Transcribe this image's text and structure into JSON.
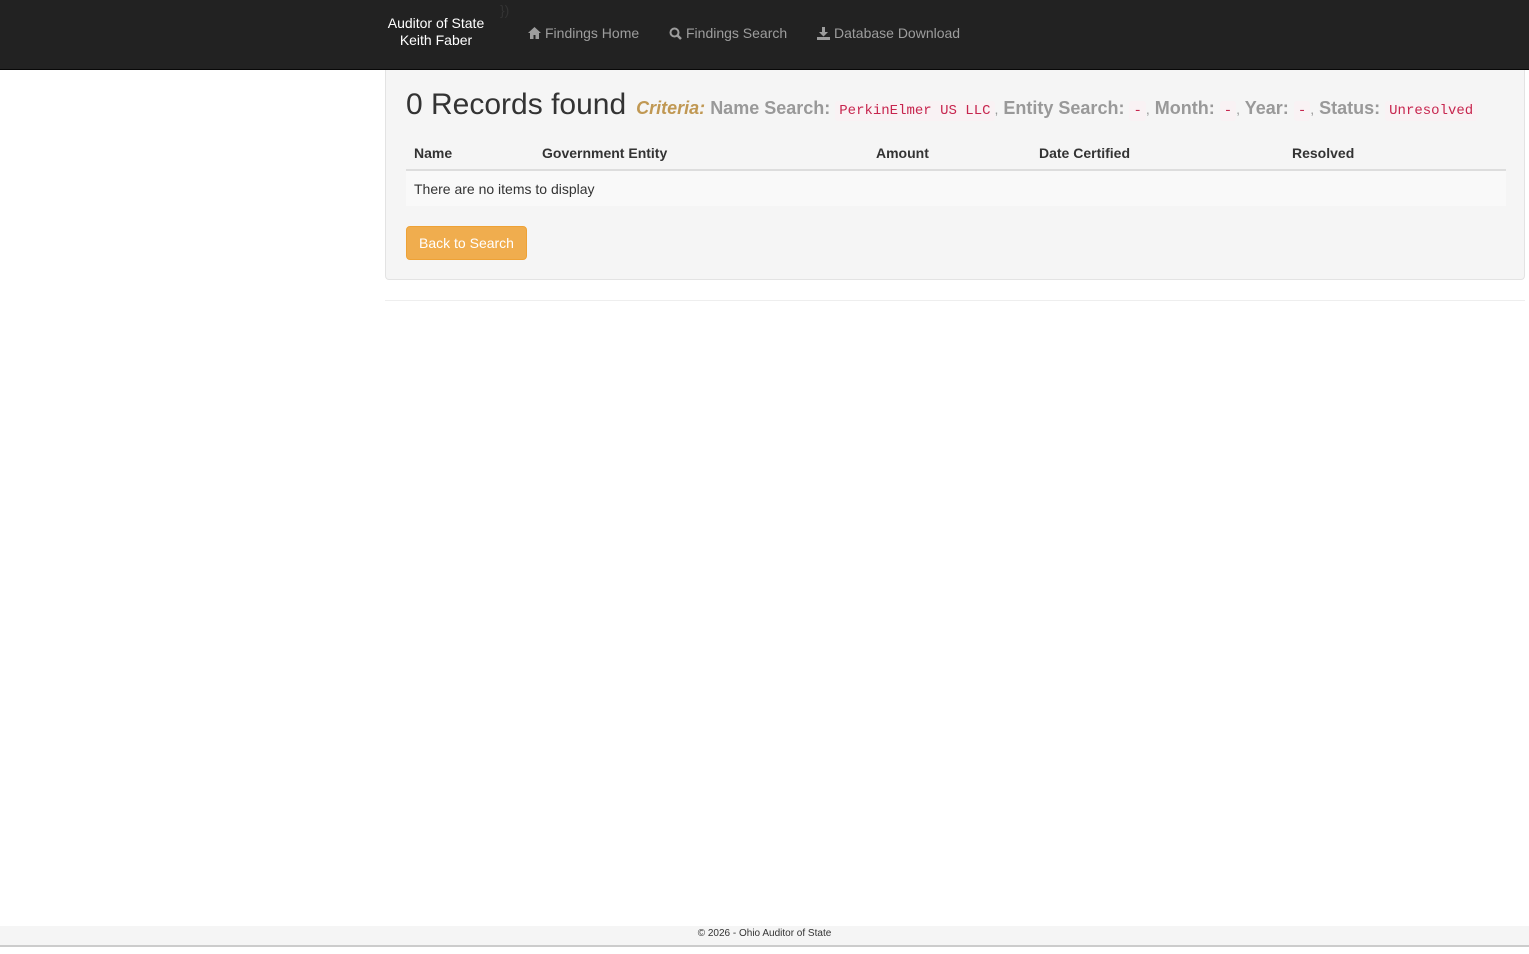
{
  "navbar": {
    "brand_line1": "Auditor of State",
    "brand_line2": "Keith Faber",
    "stray_text": "})",
    "links": [
      {
        "label": "Findings Home",
        "icon": "home-icon"
      },
      {
        "label": "Findings Search",
        "icon": "search-icon"
      },
      {
        "label": "Database Download",
        "icon": "download-icon"
      }
    ]
  },
  "results": {
    "count_text": "0 Records found",
    "criteria_label": "Criteria:",
    "name_label": "Name Search:",
    "name_value": "PerkinElmer US LLC",
    "entity_label": "Entity Search:",
    "entity_value": "-",
    "month_label": "Month:",
    "month_value": "-",
    "year_label": "Year:",
    "year_value": "-",
    "status_label": "Status:",
    "status_value": "Unresolved",
    "separator": ","
  },
  "table": {
    "columns": [
      "Name",
      "Government Entity",
      "Amount",
      "Date Certified",
      "Resolved"
    ],
    "empty_text": "There are no items to display"
  },
  "back_button": "Back to Search",
  "footer": "© 2026 - Ohio Auditor of State"
}
